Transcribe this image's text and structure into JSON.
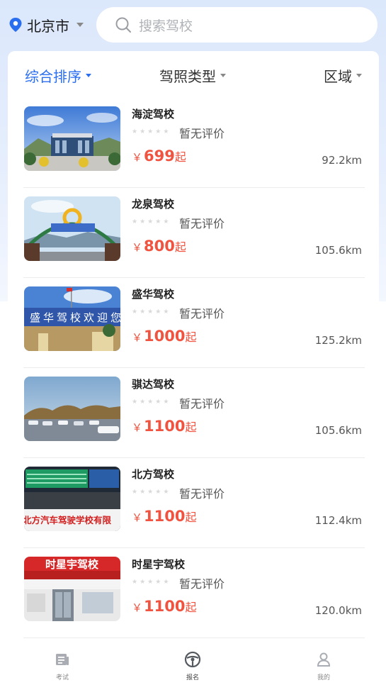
{
  "header": {
    "city": "北京市",
    "search_placeholder": "搜索驾校"
  },
  "filters": [
    {
      "label": "综合排序",
      "active": true
    },
    {
      "label": "驾照类型",
      "active": false
    },
    {
      "label": "区域",
      "active": false
    }
  ],
  "schools": [
    {
      "name": "海淀驾校",
      "rating_text": "暂无评价",
      "currency": "￥",
      "price": "699",
      "price_suffix": "起",
      "distance": "92.2km"
    },
    {
      "name": "龙泉驾校",
      "rating_text": "暂无评价",
      "currency": "￥",
      "price": "800",
      "price_suffix": "起",
      "distance": "105.6km"
    },
    {
      "name": "盛华驾校",
      "rating_text": "暂无评价",
      "currency": "￥",
      "price": "1000",
      "price_suffix": "起",
      "distance": "125.2km"
    },
    {
      "name": "骐达驾校",
      "rating_text": "暂无评价",
      "currency": "￥",
      "price": "1100",
      "price_suffix": "起",
      "distance": "105.6km"
    },
    {
      "name": "北方驾校",
      "rating_text": "暂无评价",
      "currency": "￥",
      "price": "1100",
      "price_suffix": "起",
      "distance": "112.4km"
    },
    {
      "name": "时星宇驾校",
      "rating_text": "暂无评价",
      "currency": "￥",
      "price": "1100",
      "price_suffix": "起",
      "distance": "120.0km"
    }
  ],
  "photo_text": {
    "shenghua_banner": "盛华驾校欢迎您",
    "beifang_banner": "北方汽车驾驶学校有限",
    "shixingyu_sign": "时星宇驾校"
  },
  "tabs": [
    {
      "label": "考试",
      "icon": "exam-icon",
      "active": false
    },
    {
      "label": "报名",
      "icon": "signup-icon",
      "active": true
    },
    {
      "label": "我的",
      "icon": "profile-icon",
      "active": false
    }
  ],
  "colors": {
    "accent": "#2a6ef0",
    "price": "#f0533f",
    "background_top": "#dbe7fb"
  }
}
